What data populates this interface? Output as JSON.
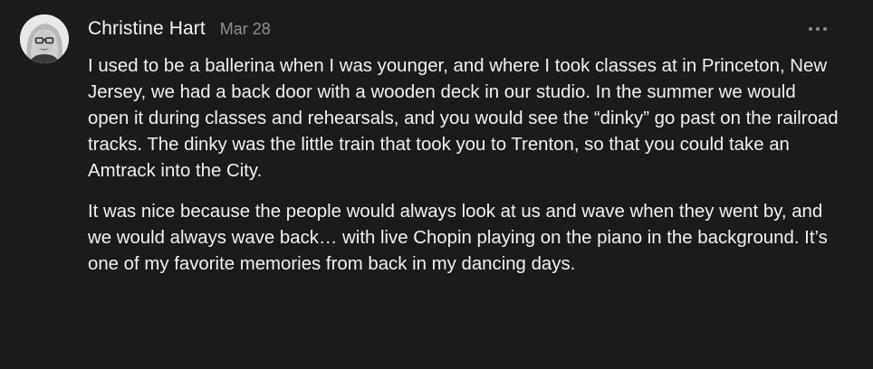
{
  "comment": {
    "author": "Christine Hart",
    "date": "Mar 28",
    "avatar_icon": "profile-photo",
    "more_icon": "more-horizontal-icon",
    "paragraphs": [
      "I used to be a ballerina when I was younger, and where I took classes at in Princeton, New Jersey, we had a back door with a wooden deck in our studio. In the summer we would open it during classes and rehearsals, and you would see the “dinky” go past on the railroad tracks. The dinky was the little train that took you to Trenton, so that you could take an Amtrack into the City.",
      "It was nice because the people would always look at us and wave when they went by, and we would always wave back… with live Chopin playing on the piano in the background. It’s one of my favorite memories from back in my dancing days."
    ]
  },
  "colors": {
    "background": "#1b1b1b",
    "text": "#f1f1f1",
    "muted": "#8e8e8e"
  }
}
